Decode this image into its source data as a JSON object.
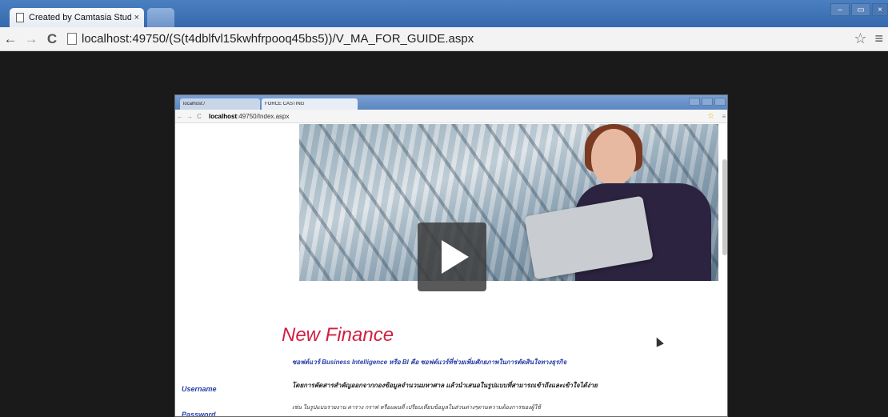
{
  "outer_browser": {
    "tab_title": "Created by Camtasia Studio",
    "tab_close": "×",
    "url": "localhost:49750/(S(t4dblfvl15kwhfrpooq45bs5))/V_MA_FOR_GUIDE.aspx",
    "icons": {
      "back": "←",
      "forward": "→",
      "reload": "C",
      "star": "☆",
      "menu": "≡",
      "minimize": "–",
      "maximize": "▭",
      "close": "×"
    }
  },
  "inner_browser": {
    "tab1_title": "localhost:/",
    "tab2_title": "FORCE CASTING",
    "url_host": "localhost",
    "url_rest": ":49750/Index.aspx",
    "star": "☆",
    "menu": "≡"
  },
  "page": {
    "headline": "New Finance",
    "line1": "ซอฟต์แวร์ Business Intelligence หรือ BI คือ ซอฟต์แวร์ที่ช่วยเพิ่มศักยภาพในการตัดสินใจทางธุรกิจ",
    "line2": "โดยการคัดสารสำคัญออกจากกองข้อมูลจำนวนมหาศาล แล้วนำเสนอในรูปแบบที่สามารถเข้าถึงและเข้าใจได้ง่าย",
    "line3": "เช่น ในรูปแบบรายงาน ตาราง กราฟ หรือแผนที่ เปรียบเทียบข้อมูลในส่วนต่างๆตามความต้องการของผู้ใช้",
    "username_label": "Username",
    "password_label": "Password"
  }
}
